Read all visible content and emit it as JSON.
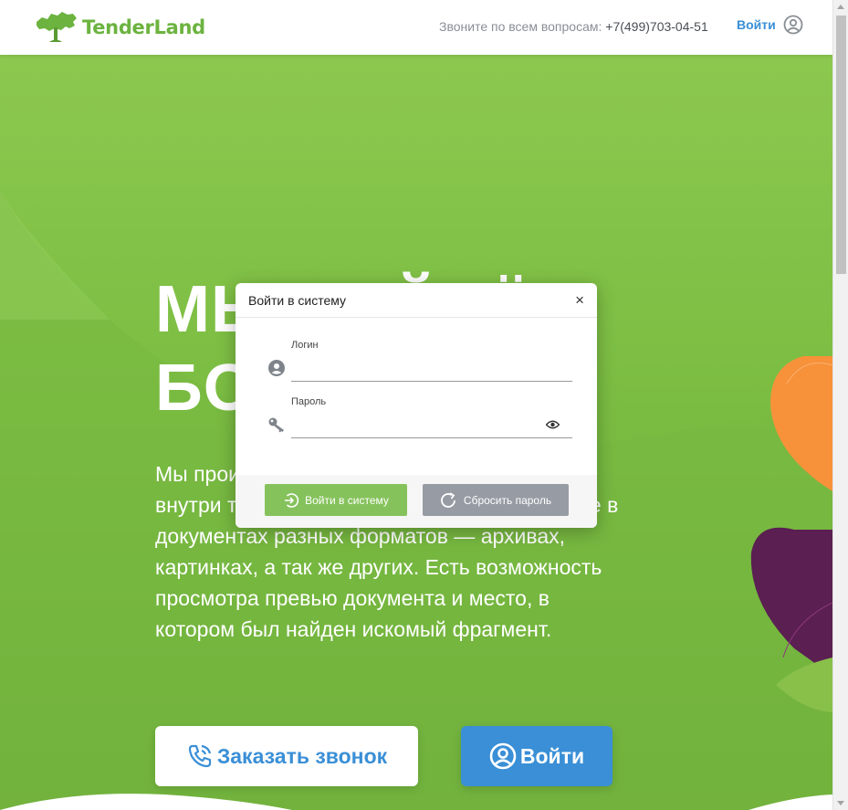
{
  "header": {
    "brand": "TenderLand",
    "phone_label": "Звоните по всем вопросам:",
    "phone_number": "+7(499)703-04-51",
    "login_label": "Войти"
  },
  "hero": {
    "title_line1": "МЫ НАЙДЁМ",
    "title_line2": "БОЛЬШЕ",
    "text_line1": "Мы производим поиск по ключевым словам",
    "text_line2": "внутри тендерной документации, в том числе в",
    "text_line3": "документах разных форматов — архивах,",
    "text_line4": "картинках, а так же других. Есть возможность",
    "text_line5": "просмотра превью документа и место, в",
    "text_line6": "котором был найден искомый фрагмент.",
    "call_button": "Заказать звонок",
    "login_button": "Войти"
  },
  "modal": {
    "title": "Войти в систему",
    "close": "×",
    "login_label": "Логин",
    "login_value": "",
    "password_label": "Пароль",
    "password_value": "",
    "submit_button": "Войти в систему",
    "reset_button": "Сбросить пароль"
  },
  "colors": {
    "brand_green": "#6cb33f",
    "accent_blue": "#3a8fd6",
    "submit_green": "#86c25c",
    "reset_gray": "#979ca4"
  }
}
